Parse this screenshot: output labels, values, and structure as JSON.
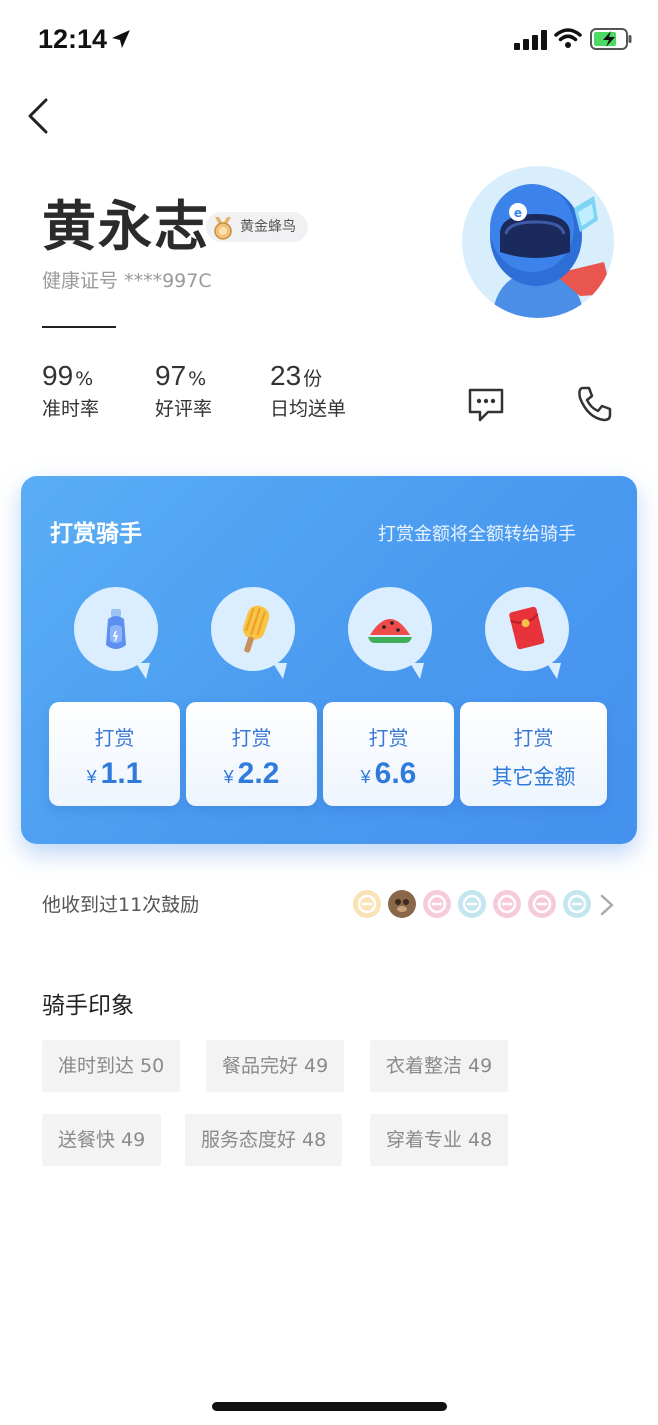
{
  "status_bar": {
    "time": "12:14"
  },
  "rider": {
    "name": "黄永志",
    "badge": "黄金蜂鸟",
    "health_label": "健康证号",
    "health_id": "****997C"
  },
  "stats": [
    {
      "value": "99",
      "unit": "%",
      "label": "准时率"
    },
    {
      "value": "97",
      "unit": "%",
      "label": "好评率"
    },
    {
      "value": "23",
      "unit": "份",
      "label": "日均送单"
    }
  ],
  "tip": {
    "title": "打赏骑手",
    "note": "打赏金额将全额转给骑手",
    "options": [
      {
        "gift_icon": "water-bottle-icon",
        "label": "打赏",
        "currency": "¥",
        "amount": "1.1"
      },
      {
        "gift_icon": "popsicle-icon",
        "label": "打赏",
        "currency": "¥",
        "amount": "2.2"
      },
      {
        "gift_icon": "watermelon-icon",
        "label": "打赏",
        "currency": "¥",
        "amount": "6.6"
      },
      {
        "gift_icon": "red-envelope-icon",
        "label": "打赏",
        "other": "其它金额"
      }
    ]
  },
  "encouragement": {
    "text": "他收到过11次鼓励"
  },
  "impressions": {
    "title": "骑手印象",
    "tags": [
      "准时到达 50",
      "餐品完好 49",
      "衣着整洁 49",
      "送餐快 49",
      "服务态度好 48",
      "穿着专业 48"
    ]
  },
  "colors": {
    "accent": "#4a9af0",
    "button_text": "#2f7bdc"
  }
}
